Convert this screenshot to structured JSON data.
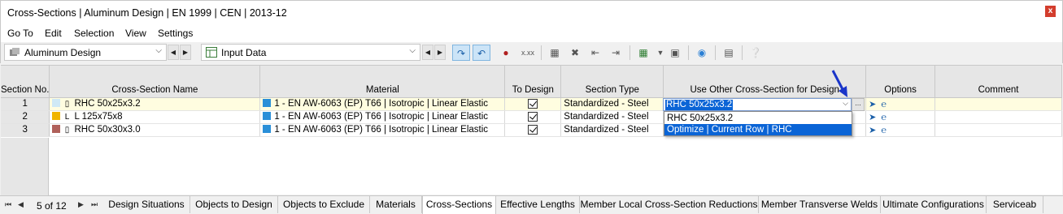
{
  "window": {
    "title": "Cross-Sections | Aluminum Design | EN 1999 | CEN | 2013-12",
    "close_glyph": "x"
  },
  "menu": [
    "Go To",
    "Edit",
    "Selection",
    "View",
    "Settings"
  ],
  "toolbar": {
    "module_combo": "Aluminum Design",
    "table_combo": "Input Data",
    "icons": [
      "select-row-icon",
      "select-table-icon",
      "pin-icon",
      "xxx-icon",
      "delete-rows-icon",
      "clear-icon",
      "insert-row-icon",
      "export-icon",
      "import-icon",
      "globe-icon",
      "table-settings-icon",
      "help-icon"
    ]
  },
  "table": {
    "headers": {
      "no": "Section No.",
      "name": "Cross-Section Name",
      "material": "Material",
      "to_design": "To Design",
      "type": "Section Type",
      "other": "Use Other Cross-Section for Design",
      "options": "Options",
      "comment": "Comment"
    },
    "rows": [
      {
        "no": "1",
        "swatch": "#cfe9f5",
        "shape": "RHC",
        "name": "RHC 50x25x3.2",
        "material": "1 - EN AW-6063 (EP) T66 | Isotropic | Linear Elastic",
        "type": "Standardized - Steel"
      },
      {
        "no": "2",
        "swatch": "#f0b400",
        "shape": "L",
        "name": "L 125x75x8",
        "material": "1 - EN AW-6063 (EP) T66 | Isotropic | Linear Elastic",
        "type": "Standardized - Steel"
      },
      {
        "no": "3",
        "swatch": "#b0605a",
        "shape": "RHC",
        "name": "RHC 50x30x3.0",
        "material": "1 - EN AW-6063 (EP) T66 | Isotropic | Linear Elastic",
        "type": "Standardized - Steel"
      }
    ],
    "material_color": "#2a8fd8"
  },
  "dropdown": {
    "value": "RHC 50x25x3.2",
    "options": [
      "RHC 50x25x3.2",
      "Optimize | Current Row | RHC"
    ],
    "dots": "..."
  },
  "tabs": {
    "pager": "5 of 12",
    "items": [
      "Design Situations",
      "Objects to Design",
      "Objects to Exclude",
      "Materials",
      "Cross-Sections",
      "Effective Lengths",
      "Member Local Cross-Section Reductions",
      "Member Transverse Welds",
      "Ultimate Configurations",
      "Serviceab"
    ],
    "active": "Cross-Sections"
  }
}
